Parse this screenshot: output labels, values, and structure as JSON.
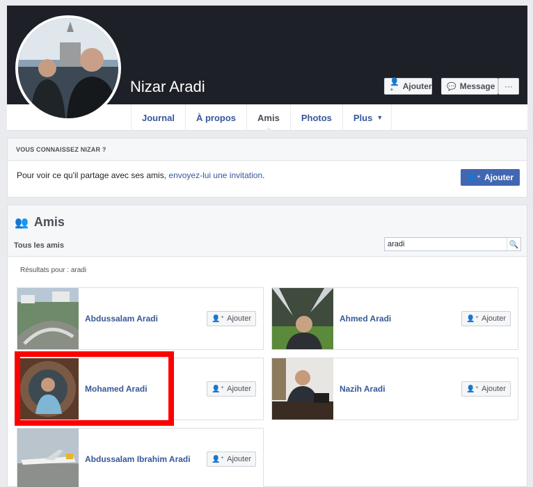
{
  "profile": {
    "name": "Nizar Aradi",
    "add_label": "Ajouter",
    "message_label": "Message",
    "more_label": "···"
  },
  "tabs": [
    {
      "label": "Journal"
    },
    {
      "label": "À propos"
    },
    {
      "label": "Amis"
    },
    {
      "label": "Photos"
    },
    {
      "label": "Plus"
    }
  ],
  "know": {
    "heading": "VOUS CONNAISSEZ NIZAR ?",
    "text_before": "Pour voir ce qu'il partage avec ses amis, ",
    "link": "envoyez-lui une invitation",
    "text_after": ".",
    "button_label": "Ajouter"
  },
  "friends": {
    "title": "Amis",
    "subtab": "Tous les amis",
    "search_value": "aradi",
    "results_label": "Résultats pour : aradi",
    "add_label": "Ajouter",
    "items": [
      {
        "name": "Abdussalam Aradi"
      },
      {
        "name": "Ahmed Aradi"
      },
      {
        "name": "Mohamed Aradi"
      },
      {
        "name": "Nazih Aradi"
      },
      {
        "name": "Abdussalam Ibrahim Aradi"
      }
    ]
  },
  "colors": {
    "link": "#365899",
    "primary_button": "#4267b2",
    "highlight": "#ff0000",
    "cover": "#1d2026"
  }
}
